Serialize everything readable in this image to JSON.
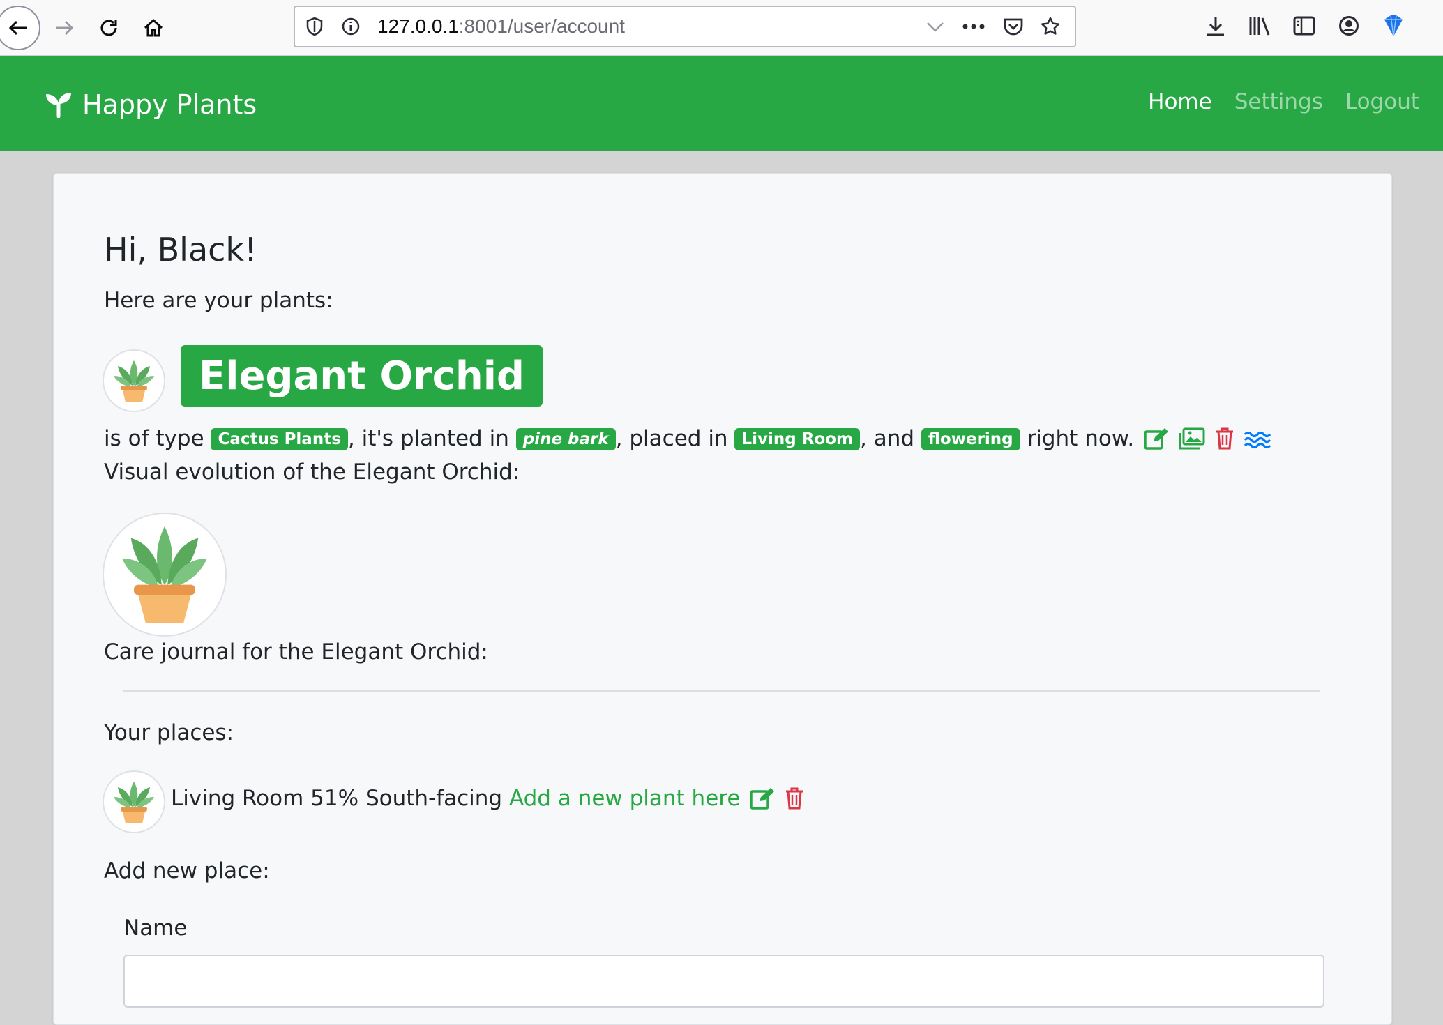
{
  "browser": {
    "url_host": "127.0.0.1",
    "url_rest": ":8001/user/account",
    "icons": [
      "back-icon",
      "forward-icon",
      "reload-icon",
      "home-icon",
      "shield-icon",
      "info-icon",
      "chevron-down-icon",
      "more-icon",
      "pocket-icon",
      "star-icon",
      "download-icon",
      "library-icon",
      "sidebar-icon",
      "account-icon",
      "extension-icon"
    ]
  },
  "navbar": {
    "brand": "Happy Plants",
    "links": [
      {
        "label": "Home",
        "active": true
      },
      {
        "label": "Settings",
        "active": false
      },
      {
        "label": "Logout",
        "active": false
      }
    ],
    "color": "#28a745"
  },
  "main": {
    "greeting": "Hi, Black!",
    "plants_intro": "Here are your plants:",
    "plant": {
      "name": "Elegant Orchid",
      "text_is_of_type": "is of type",
      "type": "Cactus Plants",
      "text_planted_in": ", it's planted in",
      "soil": "pine bark",
      "text_placed_in": ", placed in",
      "place": "Living Room",
      "text_and": ", and",
      "state": "flowering",
      "text_right_now": "right now.",
      "visual_evolution_label": "Visual evolution of the Elegant Orchid:",
      "care_journal_label": "Care journal for the Elegant Orchid:",
      "action_icons": [
        "edit-icon",
        "images-icon",
        "trash-icon",
        "water-icon"
      ]
    },
    "places_label": "Your places:",
    "place_item": {
      "name": "Living Room",
      "light": "51%",
      "orientation": "South-facing",
      "add_link": "Add a new plant here"
    },
    "add_place_label": "Add new place:",
    "form": {
      "name_label": "Name",
      "name_value": ""
    }
  }
}
